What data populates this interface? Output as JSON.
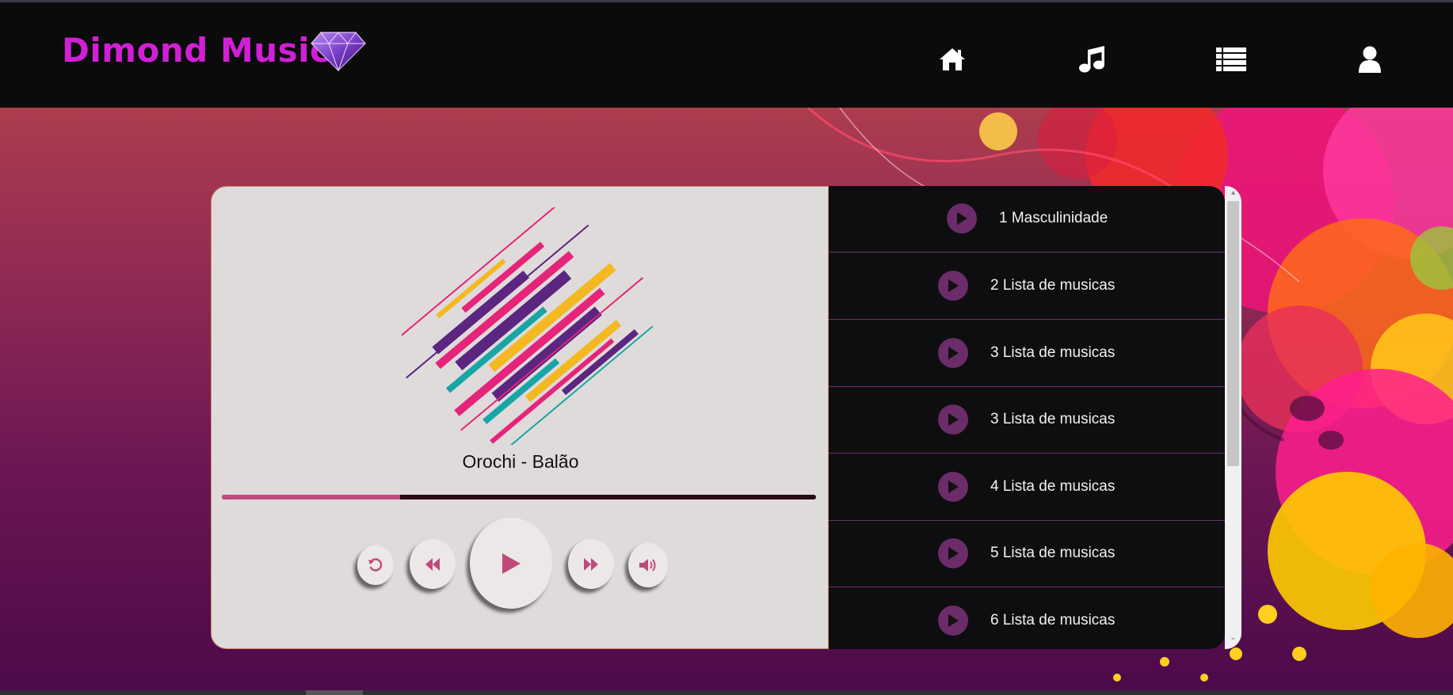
{
  "app": {
    "title": "Dimond Music"
  },
  "nav": {
    "items": [
      {
        "name": "home",
        "icon": "home-icon"
      },
      {
        "name": "music",
        "icon": "music-note-icon"
      },
      {
        "name": "list",
        "icon": "list-icon"
      },
      {
        "name": "user",
        "icon": "user-icon"
      }
    ]
  },
  "player": {
    "song_title": "Orochi - Balão",
    "progress_fraction": 0.3,
    "controls": [
      "replay-icon",
      "rewind-icon",
      "play-icon",
      "fast-forward-icon",
      "volume-icon"
    ]
  },
  "playlist": {
    "tracks": [
      {
        "label": "1 Masculinidade"
      },
      {
        "label": "2 Lista de musicas"
      },
      {
        "label": "3 Lista de musicas"
      },
      {
        "label": "3 Lista de musicas"
      },
      {
        "label": "4 Lista de musicas"
      },
      {
        "label": "5 Lista de musicas"
      },
      {
        "label": "6 Lista de musicas"
      }
    ]
  },
  "colors": {
    "brand": "#d21fd6",
    "accent": "#c0497c",
    "play_button": "#6b2c69",
    "navbar": "#0b0b0c"
  }
}
